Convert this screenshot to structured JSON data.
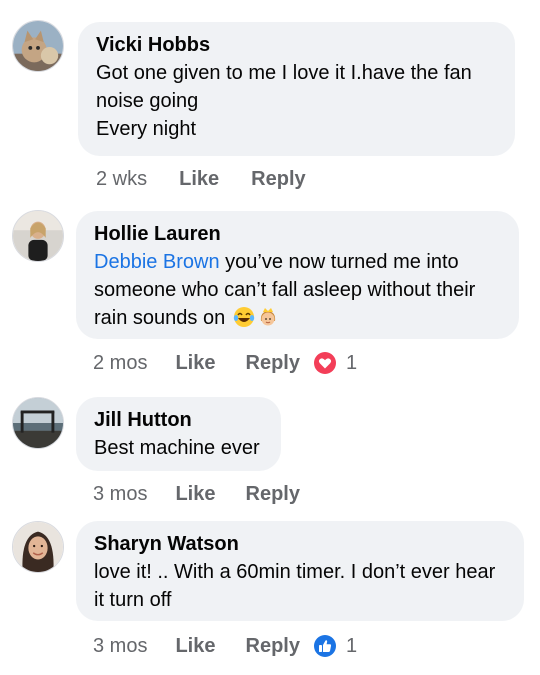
{
  "comments": [
    {
      "author": "Vicki Hobbs",
      "lines": [
        "Got one given to me I love it I.have the fan",
        "noise going",
        "Every night"
      ],
      "time": "2 wks",
      "like_label": "Like",
      "reply_label": "Reply",
      "avatar_icon": "cat-avatar-icon"
    },
    {
      "author": "Hollie Lauren",
      "mention": "Debbie Brown",
      "lines": [
        " you’ve now turned me into",
        "someone who can’t fall asleep without their",
        "rain sounds on "
      ],
      "time": "2 mos",
      "like_label": "Like",
      "reply_label": "Reply",
      "reaction": {
        "icon": "love-reaction-icon",
        "count": "1",
        "color": "#f33e58"
      },
      "emojis": [
        "laughing-tears-emoji-icon",
        "princess-emoji-icon"
      ]
    },
    {
      "author": "Jill Hutton",
      "lines": [
        "Best machine ever"
      ],
      "time": "3 mos",
      "like_label": "Like",
      "reply_label": "Reply"
    },
    {
      "author": "Sharyn Watson",
      "lines": [
        "love it! .. With a 60min timer. I don’t ever hear",
        "it turn off"
      ],
      "time": "3 mos",
      "like_label": "Like",
      "reply_label": "Reply",
      "reaction": {
        "icon": "like-reaction-icon",
        "count": "1",
        "color": "#1b74e4"
      }
    }
  ],
  "colors": {
    "bubble": "#f0f2f5",
    "meta": "#65676b",
    "mention": "#1b74e4",
    "text": "#050505"
  }
}
